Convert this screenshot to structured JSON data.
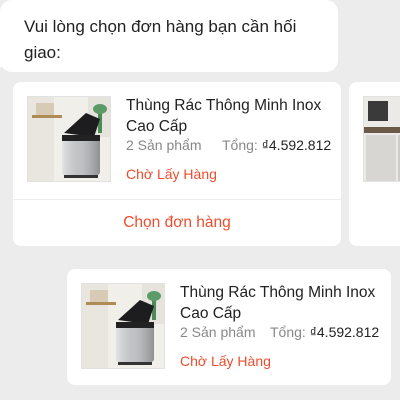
{
  "chat": {
    "prompt": "Vui lòng chọn đơn hàng bạn cần hối giao:"
  },
  "orders": [
    {
      "title": "Thùng Rác Thông Minh Inox Cao Cấp",
      "quantity": "2 Sản phẩm",
      "total_label": "Tổng:",
      "total_value": "₫4.592.812",
      "status": "Chờ Lấy Hàng",
      "action_label": "Chọn đơn hàng"
    }
  ],
  "selected_order": {
    "title": "Thùng Rác Thông Minh Inox Cao Cấp",
    "quantity": "2 Sản phẩm",
    "total_label": "Tổng:",
    "total_value": "₫4.592.812",
    "status": "Chờ Lấy Hàng"
  },
  "colors": {
    "accent": "#ee4d2d",
    "background": "#ececec",
    "card": "#ffffff"
  },
  "icons": {
    "product_image": "smart-trash-can-product-image"
  }
}
